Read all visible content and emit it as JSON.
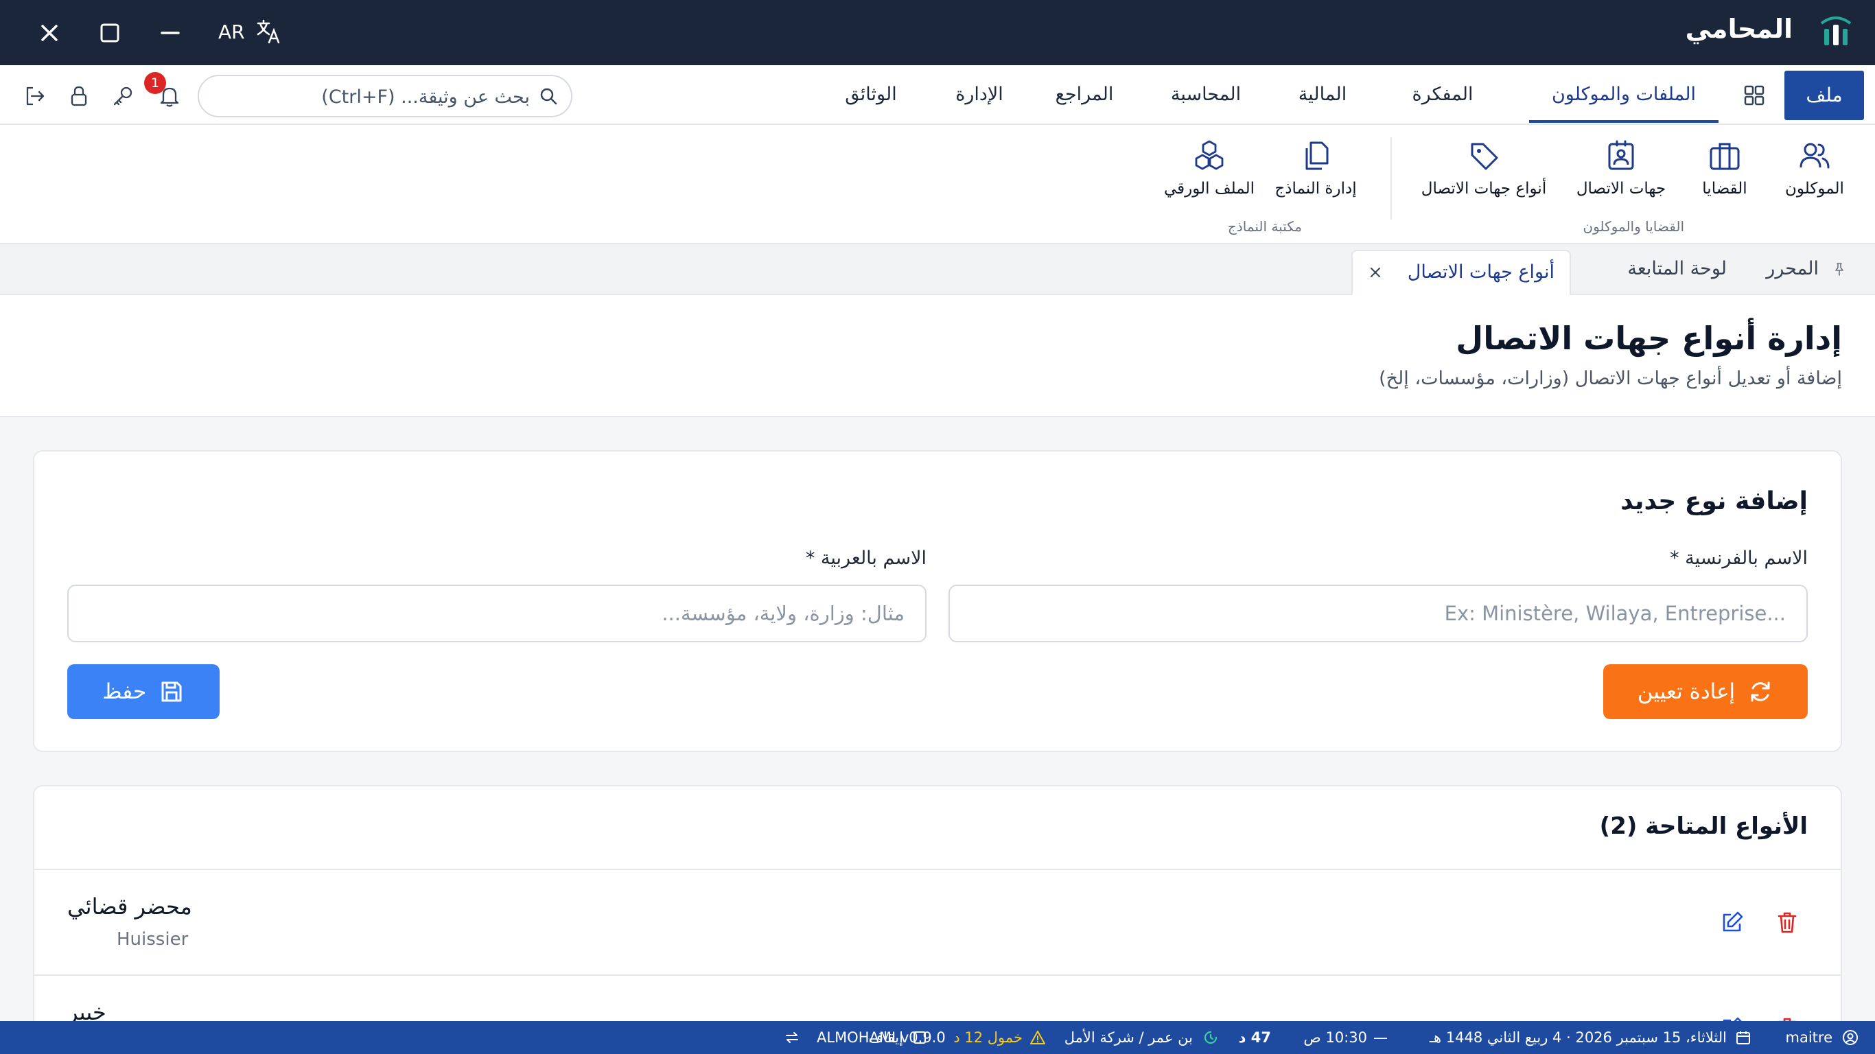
{
  "window": {
    "app_title": "المحامي",
    "language": "AR"
  },
  "menu": {
    "file": "ملف",
    "items": [
      "الملفات والموكلون",
      "المفكرة",
      "المالية",
      "المحاسبة",
      "المراجع",
      "الإدارة",
      "الوثائق"
    ],
    "active": "الملفات والموكلون"
  },
  "search": {
    "placeholder": "بحث عن وثيقة... (Ctrl+F)"
  },
  "notifications": {
    "count": "1"
  },
  "ribbon": {
    "groups": [
      {
        "label": "القضايا والموكلون",
        "buttons": [
          "الموكلون",
          "القضايا",
          "جهات الاتصال",
          "أنواع جهات الاتصال"
        ]
      },
      {
        "label": "مكتبة النماذج",
        "buttons": [
          "إدارة النماذج",
          "الملف الورقي"
        ]
      }
    ]
  },
  "tabs": {
    "items": [
      "المحرر",
      "لوحة المتابعة",
      "أنواع جهات الاتصال"
    ],
    "active": "أنواع جهات الاتصال"
  },
  "page": {
    "title": "إدارة أنواع جهات الاتصال",
    "subtitle": "إضافة أو تعديل أنواع جهات الاتصال (وزارات، مؤسسات، إلخ)"
  },
  "form": {
    "title": "إضافة نوع جديد",
    "fr_label": "الاسم بالفرنسية *",
    "fr_placeholder": "Ex: Ministère, Wilaya, Entreprise...",
    "ar_label": "الاسم بالعربية *",
    "ar_placeholder": "مثال: وزارة، ولاية، مؤسسة...",
    "reset_label": "إعادة تعيين",
    "save_label": "حفظ"
  },
  "list": {
    "title": "الأنواع المتاحة (2)",
    "rows": [
      {
        "ar": "محضر قضائي",
        "fr": "Huissier"
      },
      {
        "ar": "خبير",
        "fr": ""
      }
    ]
  },
  "status": {
    "user": "maitre",
    "date": "الثلاثاء، 15 سبتمبر 2026 · 4 ربيع الثاني 1448 هـ",
    "time": "10:30 ص",
    "timer": "47 د",
    "office": "بن عمر / شركة الأمل",
    "warning": "خمول 12 د",
    "pause": "إيقاف",
    "version": "ALMOHAMI v0.9.0"
  },
  "colors": {
    "titlebar": "#1b263b",
    "primary": "#1e4aa0",
    "save": "#3b82f6",
    "reset": "#f97316",
    "danger": "#dc2626",
    "warning": "#facc15"
  }
}
